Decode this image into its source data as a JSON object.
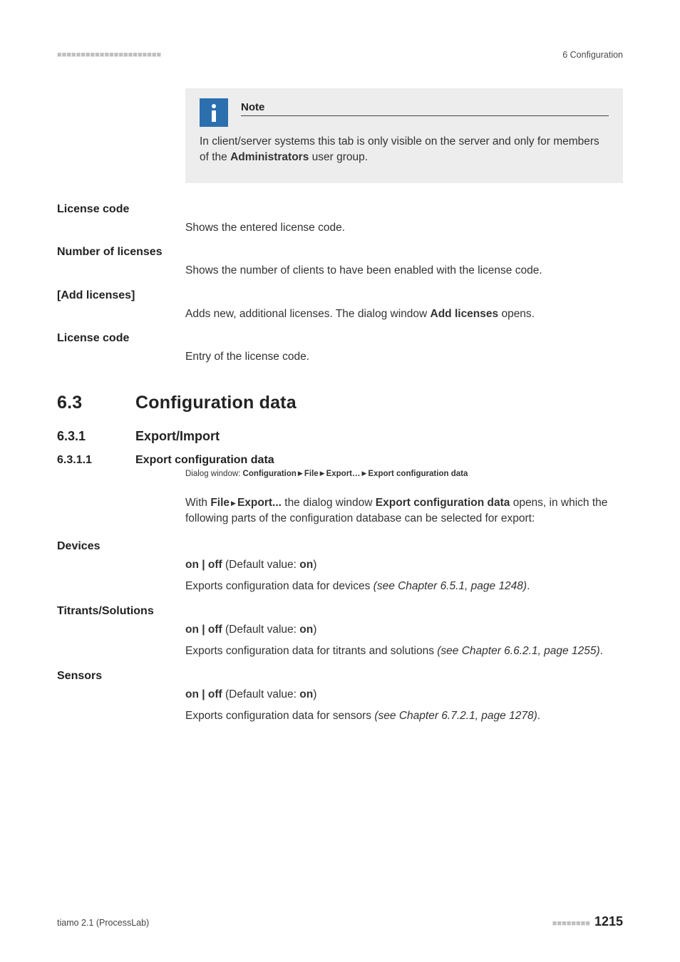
{
  "hdr": {
    "dots": "■■■■■■■■■■■■■■■■■■■■■■",
    "right": "6 Configuration"
  },
  "note": {
    "title": "Note",
    "body_pre": "In client/server systems this tab is only visible on the server and only for members of the ",
    "body_bold": "Administrators",
    "body_post": " user group."
  },
  "terms1": [
    {
      "label": "License code",
      "body": "Shows the entered license code."
    },
    {
      "label": "Number of licenses",
      "body": "Shows the number of clients to have been enabled with the license code."
    },
    {
      "label": "[Add licenses]",
      "body_pre": "Adds new, additional licenses. The dialog window ",
      "body_bold": "Add licenses",
      "body_post": " opens."
    },
    {
      "label": "License code",
      "body": "Entry of the license code."
    }
  ],
  "sec": {
    "num": "6.3",
    "title": "Configuration data"
  },
  "subsec": {
    "num": "6.3.1",
    "title": "Export/Import"
  },
  "subsub": {
    "num": "6.3.1.1",
    "title": "Export configuration data"
  },
  "dialog": {
    "prefix": "Dialog window: ",
    "parts": [
      "Configuration",
      "File",
      "Export…",
      "Export configuration data"
    ]
  },
  "intro": {
    "pre": "With ",
    "b1": "File",
    "mid1": " ▸ ",
    "b2": "Export...",
    "mid2": " the dialog window ",
    "b3": "Export configuration data",
    "post": " opens, in which the following parts of the configuration database can be selected for export:"
  },
  "opts": {
    "default_line_pre": "on | off",
    "default_line_mid": " (Default value: ",
    "default_line_val": "on",
    "default_line_post": ")"
  },
  "groups": [
    {
      "label": "Devices",
      "desc_pre": "Exports configuration data for devices ",
      "desc_i": "(see Chapter 6.5.1, page 1248)",
      "desc_post": "."
    },
    {
      "label": "Titrants/Solutions",
      "desc_pre": "Exports configuration data for titrants and solutions ",
      "desc_i": "(see Chapter 6.6.2.1, page 1255)",
      "desc_post": "."
    },
    {
      "label": "Sensors",
      "desc_pre": "Exports configuration data for sensors ",
      "desc_i": "(see Chapter 6.7.2.1, page 1278)",
      "desc_post": "."
    }
  ],
  "ftr": {
    "left": "tiamo 2.1 (ProcessLab)",
    "dots": "■■■■■■■■",
    "page": "1215"
  }
}
